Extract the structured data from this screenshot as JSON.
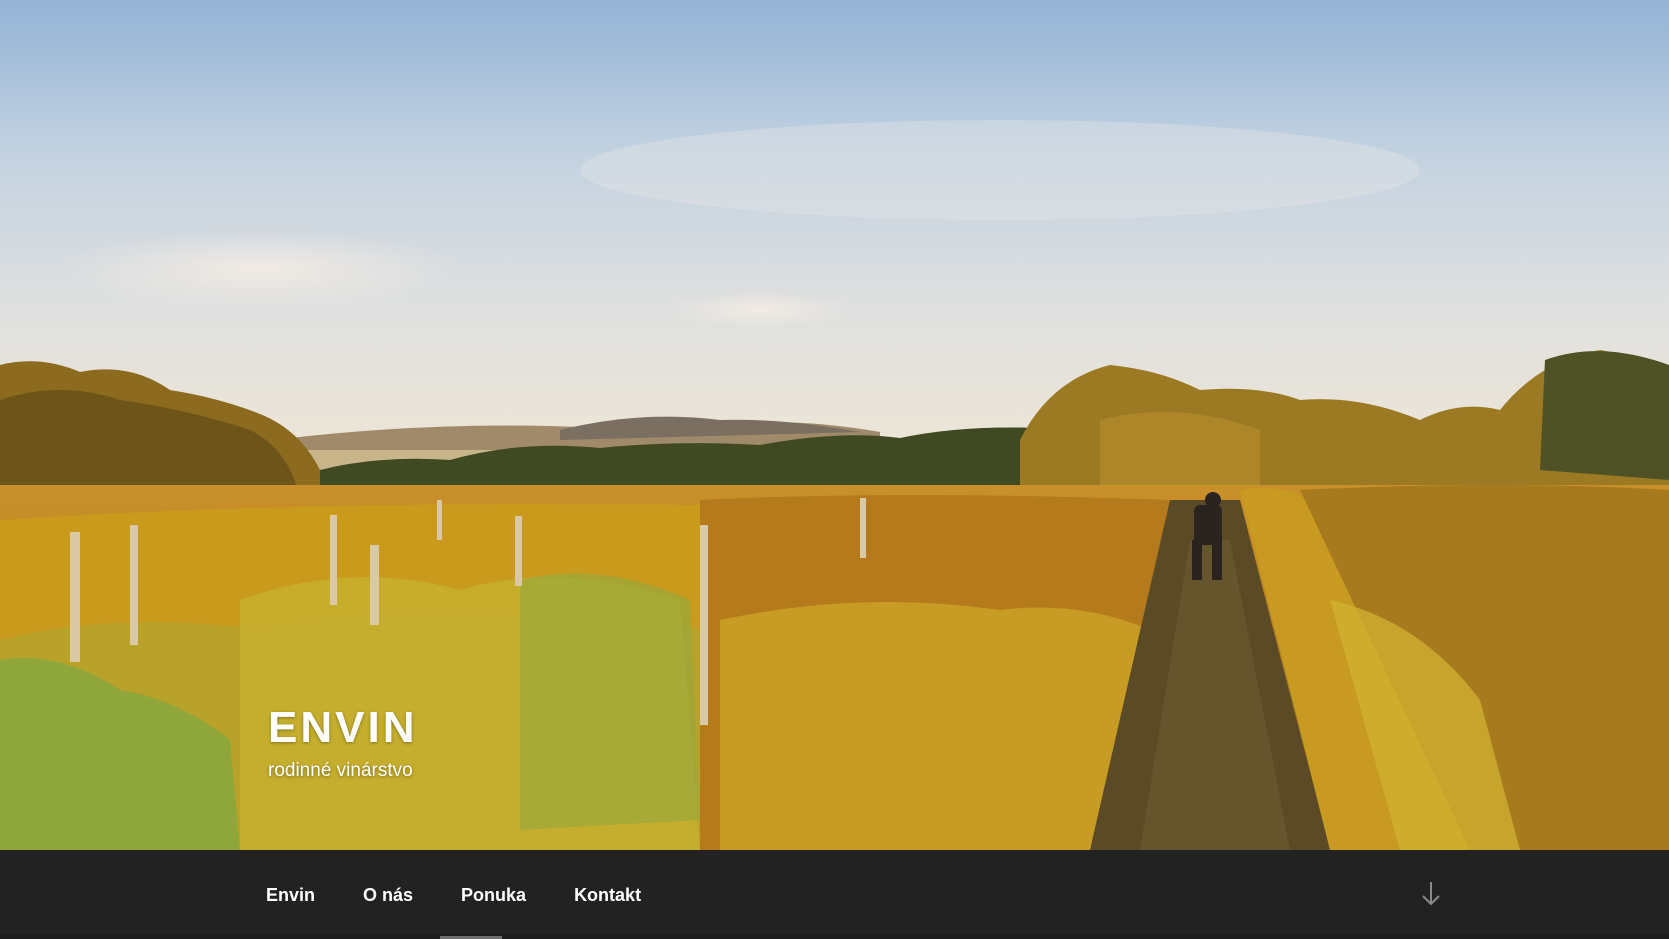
{
  "header": {
    "site_title": "ENVIN",
    "site_description": "rodinné vinárstvo",
    "hero_image": "autumn-vineyard-photo"
  },
  "navigation": {
    "items": [
      {
        "label": "Envin"
      },
      {
        "label": "O nás"
      },
      {
        "label": "Ponuka"
      },
      {
        "label": "Kontakt"
      }
    ],
    "scroll_icon": "arrow-down-icon"
  },
  "colors": {
    "nav_background": "#222222",
    "title_text": "#ffffff"
  }
}
